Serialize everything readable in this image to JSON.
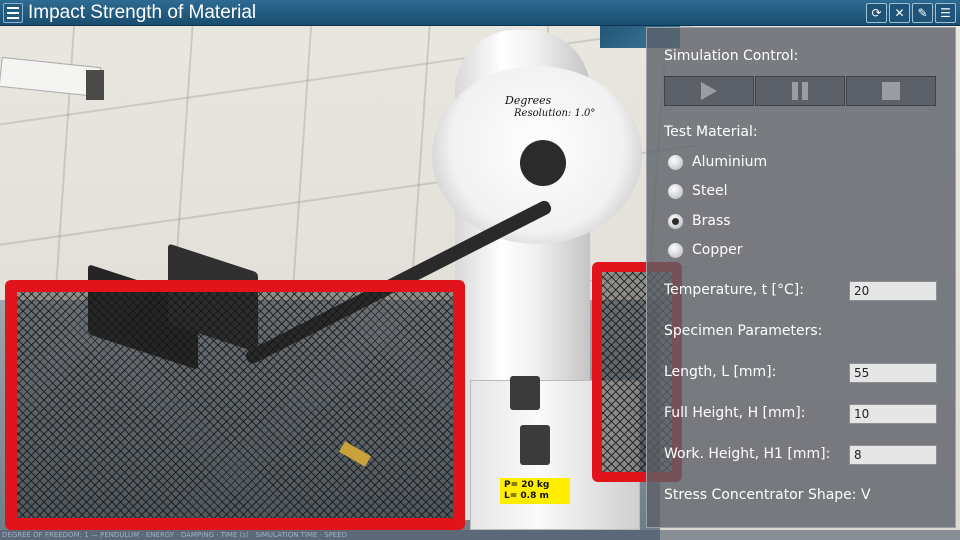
{
  "app": {
    "title": "Impact Strength of Material"
  },
  "toolbar": {
    "buttons": [
      {
        "icon": "refresh-icon",
        "glyph": "⟳"
      },
      {
        "icon": "mute-icon",
        "glyph": "✕"
      },
      {
        "icon": "note-icon",
        "glyph": "✎"
      },
      {
        "icon": "list-icon",
        "glyph": "☰"
      }
    ]
  },
  "scene": {
    "dial_title": "Degrees",
    "dial_resolution": "Resolution: 1.0°",
    "plate_line1": "P= 20 kg",
    "plate_line2": "L= 0.8 m"
  },
  "panel": {
    "simulation_control_label": "Simulation Control:",
    "test_material_label": "Test Material:",
    "materials": [
      {
        "label": "Aluminium",
        "checked": false
      },
      {
        "label": "Steel",
        "checked": false
      },
      {
        "label": "Brass",
        "checked": true
      },
      {
        "label": "Copper",
        "checked": false
      }
    ],
    "temperature_label": "Temperature, t [°C]:",
    "temperature_value": "20",
    "specimen_params_label": "Specimen Parameters:",
    "length_label": "Length, L [mm]:",
    "length_value": "55",
    "full_height_label": "Full Height, H [mm]:",
    "full_height_value": "10",
    "work_height_label": "Work. Height, H1 [mm]:",
    "work_height_value": "8",
    "stress_shape_label": "Stress Concentrator Shape: V"
  },
  "status": {
    "text": "DEGREE OF FREEDOM: 1 — PENDULUM · ENERGY · DAMPING · TIME (s) · SIMULATION TIME · SPEED"
  },
  "colors": {
    "titlebar": "#1a4d6e",
    "cage": "#e0141a",
    "panel": "#5c6068"
  }
}
